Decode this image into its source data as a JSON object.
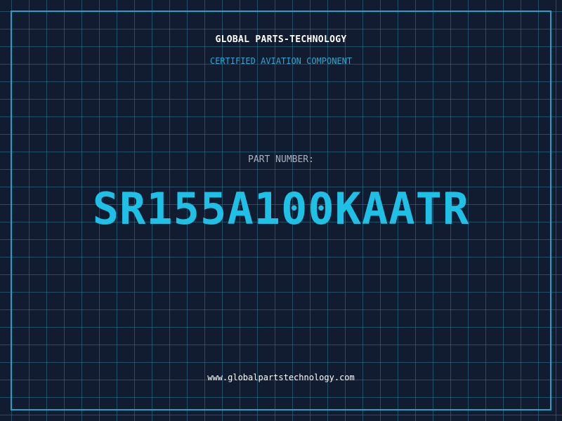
{
  "header": {
    "company": "GLOBAL PARTS-TECHNOLOGY",
    "subtitle": "CERTIFIED AVIATION COMPONENT"
  },
  "part": {
    "label": "PART NUMBER:",
    "number": "SR155A100KAATR"
  },
  "footer": {
    "website": "www.globalpartstechnology.com"
  },
  "colors": {
    "background": "#121c30",
    "grid": "#287891",
    "accent": "#1fa3c8",
    "part_number": "#1ec0e6"
  }
}
